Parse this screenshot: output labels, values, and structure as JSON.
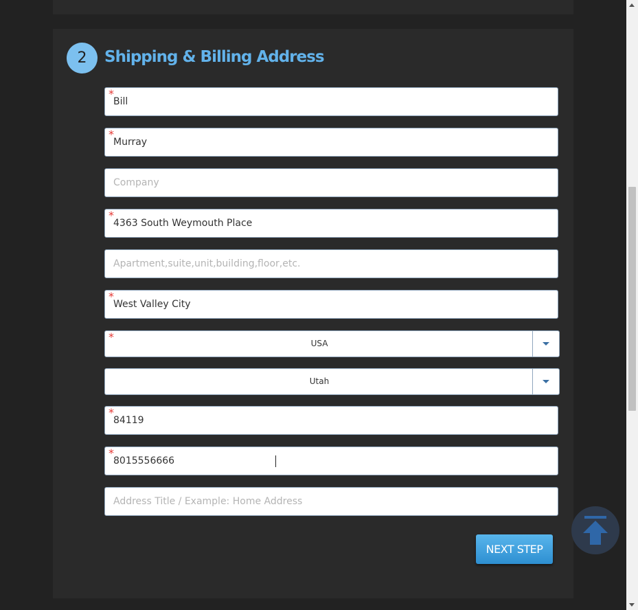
{
  "section": {
    "step_number": "2",
    "title": "Shipping & Billing Address"
  },
  "required_marker": "*",
  "fields": {
    "first_name": {
      "value": "Bill",
      "placeholder": ""
    },
    "last_name": {
      "value": "Murray",
      "placeholder": ""
    },
    "company": {
      "value": "",
      "placeholder": "Company"
    },
    "address_line1": {
      "value": "4363 South Weymouth Place",
      "placeholder": ""
    },
    "address_line2": {
      "value": "",
      "placeholder": "Apartment,suite,unit,building,floor,etc."
    },
    "city": {
      "value": "West Valley City",
      "placeholder": ""
    },
    "zip": {
      "value": "84119",
      "placeholder": ""
    },
    "phone": {
      "value": "8015556666",
      "placeholder": ""
    },
    "address_title": {
      "value": "",
      "placeholder": "Address Title / Example: Home Address"
    }
  },
  "selects": {
    "country": {
      "selected": "USA"
    },
    "state": {
      "selected": "Utah"
    }
  },
  "buttons": {
    "next_step": "NEXT STEP"
  },
  "icons": {
    "back_to_top": "arrow-up-to-line-icon",
    "dropdown": "caret-down-icon"
  },
  "colors": {
    "accent": "#62b2ea",
    "button": "#3a9ee0",
    "required": "#e53935",
    "background": "#222222",
    "panel": "#2a2a2a"
  }
}
